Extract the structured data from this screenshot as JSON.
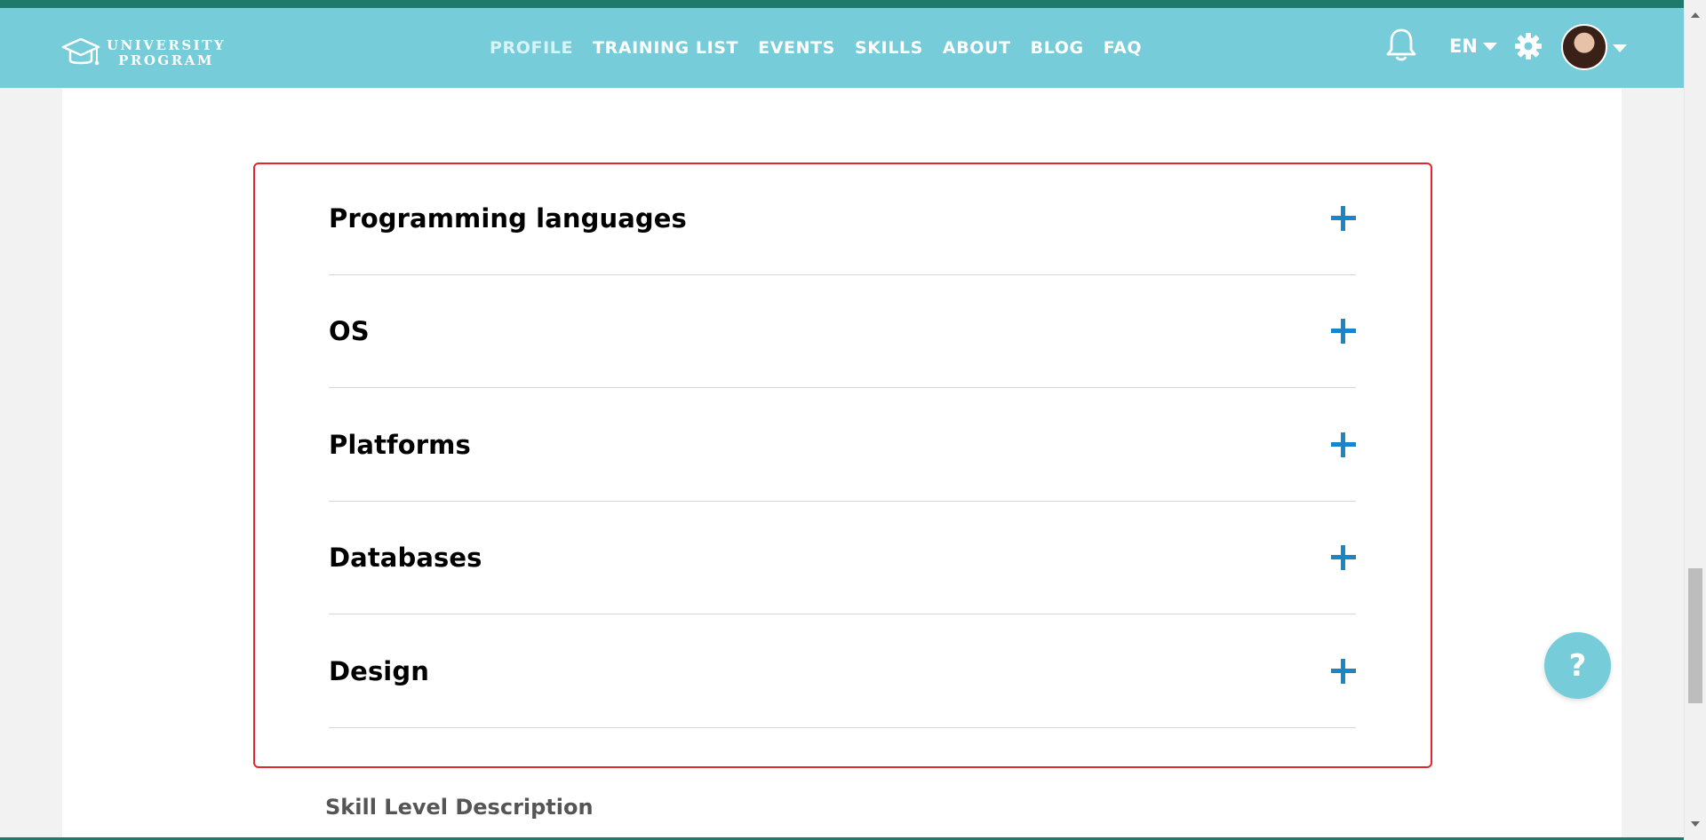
{
  "header": {
    "logo_line1": "UNIVERSITY",
    "logo_line2": "PROGRAM",
    "nav": [
      {
        "label": "PROFILE",
        "active": true
      },
      {
        "label": "TRAINING LIST"
      },
      {
        "label": "EVENTS"
      },
      {
        "label": "SKILLS"
      },
      {
        "label": "ABOUT"
      },
      {
        "label": "BLOG"
      },
      {
        "label": "FAQ"
      }
    ],
    "language": "EN",
    "icons": {
      "bell": "bell-icon",
      "settings": "gear-icon",
      "avatar_caret": "chevron-down-icon"
    }
  },
  "accordion": {
    "items": [
      {
        "label": "Programming languages",
        "icon": "plus-icon"
      },
      {
        "label": "OS",
        "icon": "plus-icon"
      },
      {
        "label": "Platforms",
        "icon": "plus-icon"
      },
      {
        "label": "Databases",
        "icon": "plus-icon"
      },
      {
        "label": "Design",
        "icon": "plus-icon"
      }
    ]
  },
  "section": {
    "title": "Skill Level Description"
  },
  "help": {
    "label": "?"
  },
  "colors": {
    "navbar": "#76ccd8",
    "top_strip": "#1f7a6c",
    "accent_plus": "#1a86c8",
    "highlight_border": "#e3262e"
  }
}
